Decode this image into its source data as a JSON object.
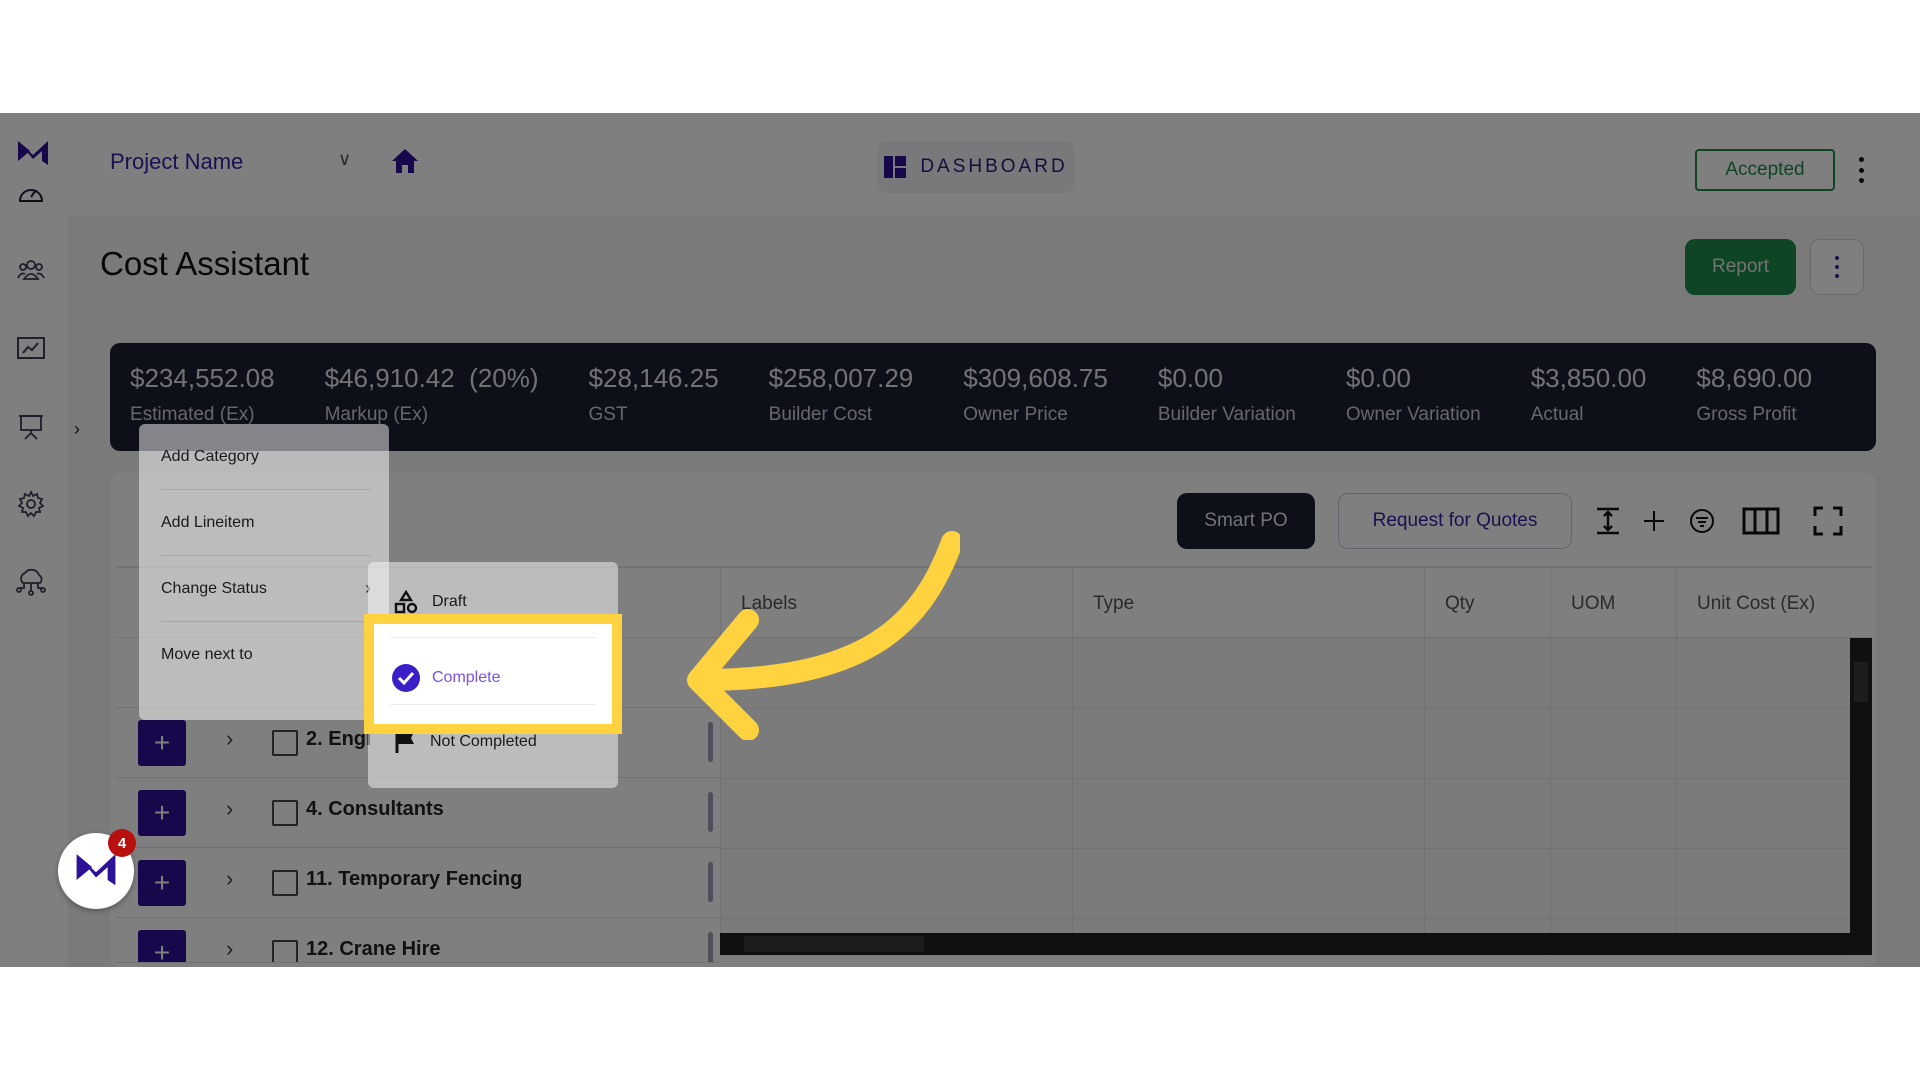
{
  "topbar": {
    "project_name": "Project Name",
    "dashboard_label": "DASHBOARD",
    "status_badge": "Accepted"
  },
  "page": {
    "title": "Cost Assistant",
    "report_label": "Report"
  },
  "summary": [
    {
      "value": "$234,552.08",
      "label": "Estimated (Ex)"
    },
    {
      "value": "$46,910.42  (20%)",
      "label": "Markup (Ex)"
    },
    {
      "value": "$28,146.25",
      "label": "GST"
    },
    {
      "value": "$258,007.29",
      "label": "Builder Cost"
    },
    {
      "value": "$309,608.75",
      "label": "Owner Price"
    },
    {
      "value": "$0.00",
      "label": "Builder Variation"
    },
    {
      "value": "$0.00",
      "label": "Owner Variation"
    },
    {
      "value": "$3,850.00",
      "label": "Actual"
    },
    {
      "value": "$8,690.00",
      "label": "Gross Profit"
    }
  ],
  "toolbar": {
    "smart_po": "Smart PO",
    "rfq": "Request for Quotes"
  },
  "table": {
    "columns": [
      "Labels",
      "Type",
      "Qty",
      "UOM",
      "Unit Cost (Ex)"
    ],
    "rows": [
      {
        "name": "2. Engi"
      },
      {
        "name": "4. Consultants"
      },
      {
        "name": "11. Temporary Fencing"
      },
      {
        "name": "12. Crane Hire"
      }
    ]
  },
  "context_menu": {
    "items": [
      "Add Category",
      "Add Lineitem",
      "Change Status",
      "Move next to"
    ],
    "status_submenu": [
      "Draft",
      "Complete",
      "Not Completed"
    ]
  },
  "notifications": {
    "count": "4"
  },
  "colors": {
    "brand": "#2d1196",
    "accent_green": "#1a8a4a",
    "highlight": "#ffd23f",
    "summary_bg": "#1d2133"
  }
}
